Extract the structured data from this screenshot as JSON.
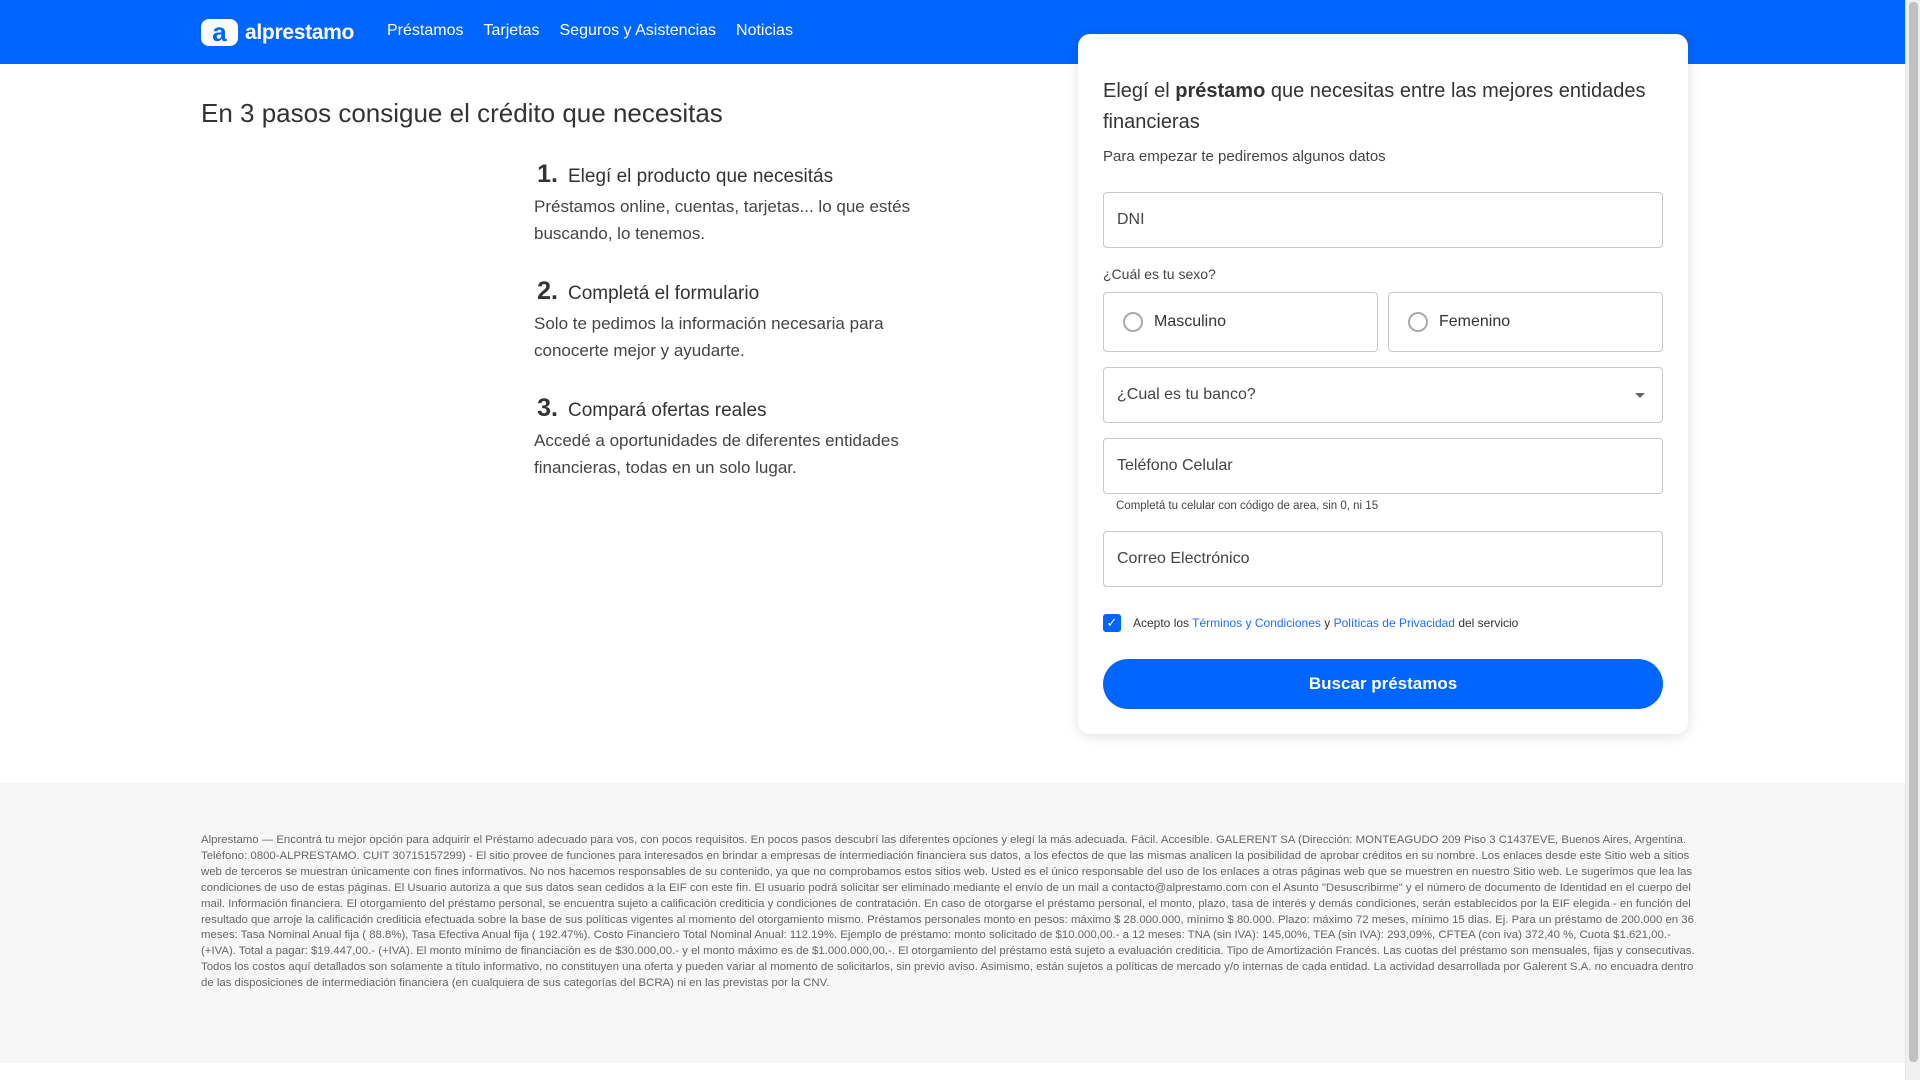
{
  "nav": {
    "logo_mark": "a",
    "logo_text": "alprestamo",
    "links": [
      "Préstamos",
      "Tarjetas",
      "Seguros y Asistencias",
      "Noticias"
    ]
  },
  "hero": {
    "title": "En 3 pasos consigue el crédito que necesitas",
    "steps": [
      {
        "num": "1.",
        "title": "Elegí el producto que necesitás",
        "text": "Préstamos online, cuentas, tarjetas... lo que estés buscando, lo tenemos."
      },
      {
        "num": "2.",
        "title": "Completá el formulario",
        "text": "Solo te pedimos la información necesaria para conocerte mejor y ayudarte."
      },
      {
        "num": "3.",
        "title": "Compará ofertas reales",
        "text": "Accedé a oportunidades de diferentes entidades financieras, todas en un solo lugar."
      }
    ]
  },
  "form": {
    "title_pre": "Elegí el ",
    "title_bold": "préstamo",
    "title_post": " que necesitas entre las mejores entidades financieras",
    "subtitle": "Para empezar te pediremos algunos datos",
    "dni_placeholder": "DNI",
    "sex_label": "¿Cuál es tu sexo?",
    "sex_options": [
      "Masculino",
      "Femenino"
    ],
    "bank_placeholder": "¿Cual es tu banco?",
    "phone_placeholder": "Teléfono Celular",
    "phone_hint": "Completá tu celular con código de area, sin 0, ni 15",
    "email_placeholder": "Correo Electrónico",
    "terms_pre": "Acepto los",
    "terms_link": "Términos y Condiciones",
    "terms_and": "y",
    "privacy_link": "Políticas de Privacidad",
    "terms_post": "del servicio",
    "terms_checked": true,
    "submit": "Buscar préstamos"
  },
  "footer": {
    "text": "Alprestamo — Encontrá tu mejor opción para adquirir el Préstamo adecuado para vos, con pocos requisitos. En pocos pasos descubrí las diferentes opciones y elegí la más adecuada. Fácil. Accesible. GALERENT SA (Dirección: MONTEAGUDO 209 Piso 3 C1437EVE, Buenos Aires, Argentina. Teléfono: 0800-ALPRESTAMO. CUIT 30715157299) - El sitio provee de funciones para interesados en brindar a empresas de intermediación financiera sus datos, a los efectos de que las mismas analicen la posibilidad de aprobar créditos en su nombre. Los enlaces desde este Sitio web a sitios web de terceros se muestran únicamente con fines informativos. No nos hacemos responsables de su contenido, ya que no comprobamos estos sitios web. Usted es el único responsable del uso de los enlaces a otras páginas web que se muestren en nuestro Sitio web. Le sugerimos que lea las condiciones de uso de estas páginas. El Usuario autoriza a que sus datos sean cedidos a la EIF con este fin. El usuario podrá solicitar ser eliminado mediante el envío de un mail a contacto@alprestamo.com con el Asunto \"Desuscribirme\" y el número de documento de Identidad en el cuerpo del mail. Información financiera. El otorgamiento del préstamo personal, se encuentra sujeto a calificación crediticia y condiciones de contratación. En caso de otorgarse el préstamo personal, el monto, plazo, tasa de interés y demás condiciones, serán establecidos por la EIF elegida - en función del resultado que arroje la calificación crediticia efectuada sobre la base de sus políticas vigentes al momento del otorgamiento mismo. Préstamos personales monto en pesos: máximo $ 28.000.000, mínimo $ 80.000. Plazo: máximo 72 meses, mínimo 15 dias. Ej. Para un préstamo de 200.000 en 36 meses: Tasa Nominal Anual fija ( 88.8%), Tasa Efectiva Anual fija ( 192.47%). Costo Financiero Total Nominal Anual: 112.19%. Ejemplo de préstamo: monto solicitado de $10.000,00.- a 12 meses: TNA (sin IVA): 145,00%, TEA (sin IVA): 293,09%, CFTEA (con iva) 372,40 %, Cuota $1.621,00.- (+IVA). Total a pagar: $19.447,00.- (+IVA). El monto mínimo de financiación es de $30.000,00.- y el monto máximo es de $1.000.000,00.-. El otorgamiento del préstamo está sujeto a evaluación crediticia. Tipo de Amortización Francés. Las cuotas del préstamo son mensuales, fijas y consecutivas. Todos los costos aquí detallados son solamente a título informativo, no constituyen una oferta y pueden variar al momento de solicitarlos, sin previo aviso. Asimismo, están sujetos a políticas de mercado y/o internas de cada entidad. La actividad desarrollada por Galerent S.A. no encuadra dentro de las disposiciones de intermediación financiera (en cualquiera de sus categorías del BCRA) ni en las previstas por la CNV."
  },
  "colors": {
    "brand": "#0066ff"
  }
}
